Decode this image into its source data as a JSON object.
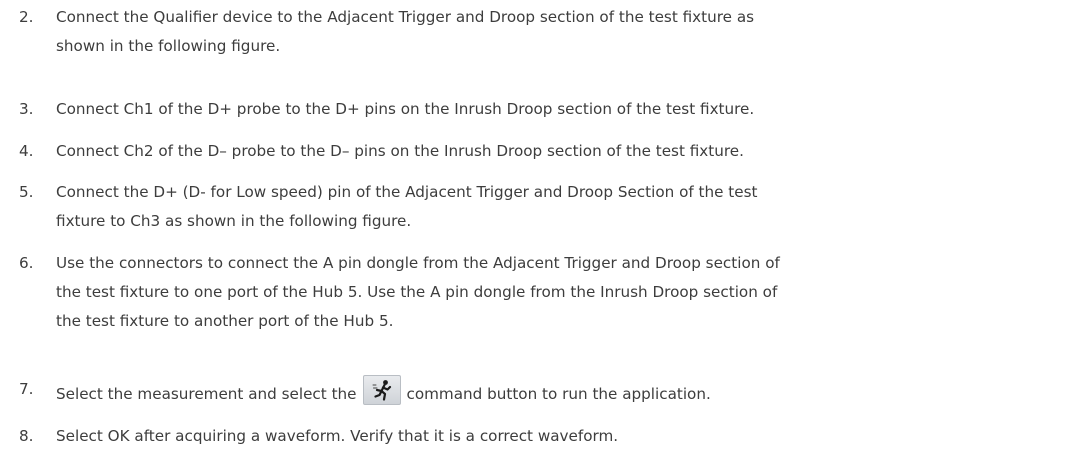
{
  "steps": [
    {
      "num": "2.",
      "lines": [
        "Connect the Qualifier device to the Adjacent Trigger and Droop section of the test fixture as",
        "shown in the following figure."
      ]
    },
    {
      "num": "3.",
      "lines": [
        "Connect Ch1 of the D+ probe to the D+ pins on the Inrush Droop section of the test fixture."
      ]
    },
    {
      "num": "4.",
      "lines": [
        "Connect Ch2 of the D– probe to the D– pins on the Inrush Droop section of the test fixture."
      ]
    },
    {
      "num": "5.",
      "lines": [
        "Connect the D+ (D- for Low speed) pin of the Adjacent Trigger and Droop Section of the test",
        "fixture to Ch3 as shown in the following figure."
      ]
    },
    {
      "num": "6.",
      "lines": [
        "Use the connectors to connect the A pin dongle from the Adjacent Trigger and Droop section of",
        "the test fixture to one port of the Hub 5. Use the A pin dongle from the Inrush Droop section of",
        "the test fixture to another port of the Hub 5."
      ]
    },
    {
      "num": "7.",
      "before": "Select the measurement and select the",
      "after": "command button to run the application.",
      "icon": "run-icon"
    },
    {
      "num": "8.",
      "lines": [
        "Select OK after acquiring a waveform. Verify that it is a correct waveform."
      ]
    }
  ]
}
